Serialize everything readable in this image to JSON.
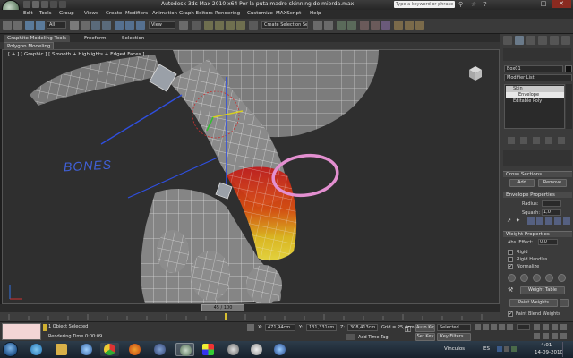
{
  "window": {
    "title": "Autodesk 3ds Max  2010 x64      Por la puta madre skinning de mierda.max",
    "search_placeholder": "Type a keyword or phrase"
  },
  "menu": [
    "Edit",
    "Tools",
    "Group",
    "Views",
    "Create",
    "Modifiers",
    "Animation",
    "Graph Editors",
    "Rendering",
    "Customize",
    "MAXScript",
    "Help"
  ],
  "toolbar": {
    "selection_filter": "All",
    "reference_coord": "View",
    "named_selection": "Create Selection Set"
  },
  "ribbon": {
    "tabs": [
      "Graphite Modeling Tools",
      "Freeform",
      "Selection"
    ],
    "active_panel": "Polygon Modeling"
  },
  "viewport": {
    "label": "[ + ] [ Graphic ] [ Smooth + Highlights + Edged Faces ]",
    "annotation": "BONES"
  },
  "command_panel": {
    "object_name": "Box01",
    "modifier_list": "Modifier List",
    "stack": [
      "Skin",
      "Envelope",
      "Editable Poly"
    ],
    "cross_sections": {
      "title": "Cross Sections",
      "add": "Add",
      "remove": "Remove"
    },
    "envelope_properties": {
      "title": "Envelope Properties",
      "radius_label": "Radius:",
      "radius_value": "",
      "squash_label": "Squash:",
      "squash_value": "1,0"
    },
    "weight_properties": {
      "title": "Weight Properties",
      "abs_effect_label": "Abs. Effect:",
      "abs_effect_value": "0,0",
      "rigid": "Rigid",
      "rigid_handles": "Rigid Handles",
      "normalize": "Normalize",
      "weight_table": "Weight Table",
      "paint_weights": "Paint Weights",
      "paint_blend_weights": "Paint Blend Weights"
    }
  },
  "timeline": {
    "slider": "45 / 100"
  },
  "status": {
    "selected": "1 Object Selected",
    "rendering_time": "Rendering Time  0:00:09",
    "x": "471,94cm",
    "y": "131,331cm",
    "z": "308,413cm",
    "grid": "Grid = 25,4cm",
    "add_time_tag": "Add Time Tag",
    "auto_key": "Auto Key",
    "key_mode": "Selected",
    "set_key": "Set Key",
    "key_filters": "Key Filters..."
  },
  "taskbar": {
    "vinculos": "Vínculos",
    "lang": "ES",
    "time": "4:01",
    "date": "14-09-2010"
  },
  "colors": {
    "accent_blue": "#4060d8",
    "pink_ring": "#e38fd0"
  }
}
